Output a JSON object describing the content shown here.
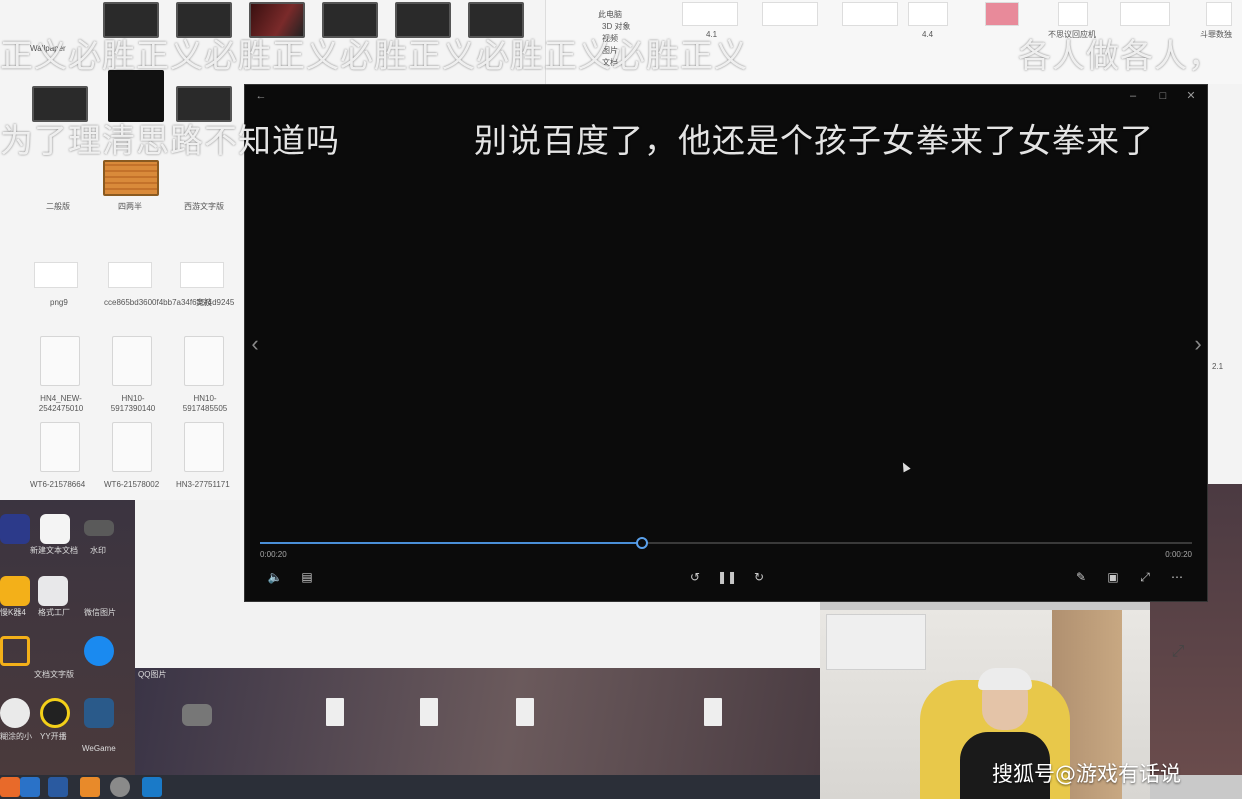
{
  "danmaku": [
    "正义必胜正义必胜正义必胜正义必胜正义必胜正义",
    "各人做各人，",
    "为了理清思路不知道吗",
    "别说百度了，他还是个孩子女拳来了女拳来了"
  ],
  "explorer": {
    "tree_items": [
      "此电脑",
      "3D 对象",
      "视频",
      "图片",
      "文档"
    ],
    "thumb_labels": [
      "Wallpaper",
      "二般版",
      "四两半",
      "西游文字版"
    ],
    "file_labels": [
      "png9",
      "cce865bd3600f4bb7a34f635f4d9245",
      "竞技",
      "HN4_NEW-2542475010",
      "HN10-5917390140",
      "HN10-5917485505",
      "WT6-21578664",
      "WT6-21578002",
      "HN3-27751171"
    ],
    "right_labels": [
      "4.1",
      "4.4",
      "不思议回应机",
      "斗罪数独",
      "2.1"
    ]
  },
  "desktop": {
    "labels": [
      "新建文本文档",
      "水印",
      "慢K器4",
      "格式工厂",
      "微信图片",
      "文档文字版",
      "QQ图片",
      "糊涂的小",
      "YY开播",
      "WeGame"
    ]
  },
  "player": {
    "back_icon": "arrow-left-icon",
    "current_time": "0:00:20",
    "total_time": "0:00:20",
    "progress": 0.41,
    "colors": {
      "accent": "#4a8fd8",
      "background": "#0b0b0b"
    }
  },
  "watermark": "搜狐号@游戏有话说"
}
